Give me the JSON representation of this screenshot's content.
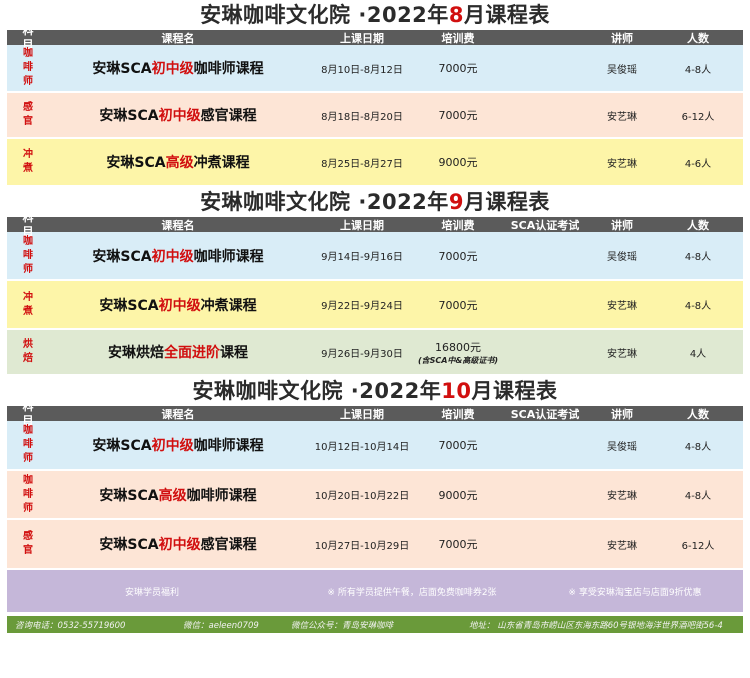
{
  "colors": {
    "blue": "#d9edf7",
    "peach": "#fde5d6",
    "yellow": "#fdf5a8",
    "green": "#dfe9d2",
    "accent": "#d10f0f"
  },
  "sections": [
    {
      "title_pre": "安琳咖啡文化院 ·2022年",
      "title_month": "8",
      "title_post": "月课程表",
      "headers": [
        "科目",
        "课程名",
        "上课日期",
        "培训费",
        "",
        "讲师",
        "人数"
      ],
      "rows": [
        {
          "subject": "咖啡师",
          "name_pre": "安琳SCA",
          "name_hl": "初中级",
          "name_post": "咖啡师课程",
          "date": "8月10日-8月12日",
          "fee": "7000元",
          "fee_note": "",
          "cert": "",
          "teacher": "吴俊瑶",
          "size": "4-8人",
          "bg": "blue"
        },
        {
          "subject": "感官",
          "name_pre": "安琳SCA",
          "name_hl": "初中级",
          "name_post": "感官课程",
          "date": "8月18日-8月20日",
          "fee": "7000元",
          "fee_note": "",
          "cert": "",
          "teacher": "安艺琳",
          "size": "6-12人",
          "bg": "peach"
        },
        {
          "subject": "冲煮",
          "name_pre": "安琳SCA",
          "name_hl": "高级",
          "name_post": "冲煮课程",
          "date": "8月25日-8月27日",
          "fee": "9000元",
          "fee_note": "",
          "cert": "",
          "teacher": "安艺琳",
          "size": "4-6人",
          "bg": "yellow"
        }
      ]
    },
    {
      "title_pre": "安琳咖啡文化院 ·2022年",
      "title_month": "9",
      "title_post": "月课程表",
      "headers": [
        "科目",
        "课程名",
        "上课日期",
        "培训费",
        "SCA认证考试",
        "讲师",
        "人数"
      ],
      "rows": [
        {
          "subject": "咖啡师",
          "name_pre": "安琳SCA",
          "name_hl": "初中级",
          "name_post": "咖啡师课程",
          "date": "9月14日-9月16日",
          "fee": "7000元",
          "fee_note": "",
          "cert": "",
          "teacher": "吴俊瑶",
          "size": "4-8人",
          "bg": "blue"
        },
        {
          "subject": "冲煮",
          "name_pre": "安琳SCA",
          "name_hl": "初中级",
          "name_post": "冲煮课程",
          "date": "9月22日-9月24日",
          "fee": "7000元",
          "fee_note": "",
          "cert": "",
          "teacher": "安艺琳",
          "size": "4-8人",
          "bg": "yellow"
        },
        {
          "subject": "烘焙",
          "name_pre": "安琳烘焙",
          "name_hl": "全面进阶",
          "name_post": "课程",
          "date": "9月26日-9月30日",
          "fee": "16800元",
          "fee_note": "(含SCA中&高级证书)",
          "cert": "",
          "teacher": "安艺琳",
          "size": "4人",
          "bg": "green"
        }
      ]
    },
    {
      "title_pre": "安琳咖啡文化院 ·2022年",
      "title_month": "10",
      "title_post": "月课程表",
      "headers": [
        "科目",
        "课程名",
        "上课日期",
        "培训费",
        "SCA认证考试",
        "讲师",
        "人数"
      ],
      "rows": [
        {
          "subject": "咖啡师",
          "name_pre": "安琳SCA",
          "name_hl": "初中级",
          "name_post": "咖啡师课程",
          "date": "10月12日-10月14日",
          "fee": "7000元",
          "fee_note": "",
          "cert": "",
          "teacher": "吴俊瑶",
          "size": "4-8人",
          "bg": "blue"
        },
        {
          "subject": "咖啡师",
          "name_pre": "安琳SCA",
          "name_hl": "高级",
          "name_post": "咖啡师课程",
          "date": "10月20日-10月22日",
          "fee": "9000元",
          "fee_note": "",
          "cert": "",
          "teacher": "安艺琳",
          "size": "4-8人",
          "bg": "peach"
        },
        {
          "subject": "感官",
          "name_pre": "安琳SCA",
          "name_hl": "初中级",
          "name_post": "感官课程",
          "date": "10月27日-10月29日",
          "fee": "7000元",
          "fee_note": "",
          "cert": "",
          "teacher": "安艺琳",
          "size": "6-12人",
          "bg": "peach"
        }
      ]
    }
  ],
  "benefits": {
    "label": "安琳学员福利",
    "item1": "※ 所有学员提供午餐，店面免费咖啡券2张",
    "item2": "※ 享受安琳淘宝店与店面9折优惠"
  },
  "footer": {
    "phone": "咨询电话：0532-55719600",
    "wechat": "微信：aeleen0709",
    "official": "微信公众号：青岛安琳咖啡",
    "address": "地址： 山东省青岛市崂山区东海东路60号银地海洋世界酒吧街56-4"
  }
}
